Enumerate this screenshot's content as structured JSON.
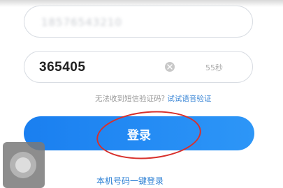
{
  "phone_field": {
    "value": "18576543210"
  },
  "code_field": {
    "value": "365405",
    "countdown": "55秒",
    "clear_icon": "clear-circle-icon"
  },
  "hint": {
    "text": "无法收到短信验证码?",
    "voice_link": "试试语音验证"
  },
  "login_button": {
    "label": "登录",
    "color": "#1a7ff0"
  },
  "one_click_login": {
    "label": "本机号码一键登录"
  },
  "annotation": {
    "color": "#d8302b"
  }
}
